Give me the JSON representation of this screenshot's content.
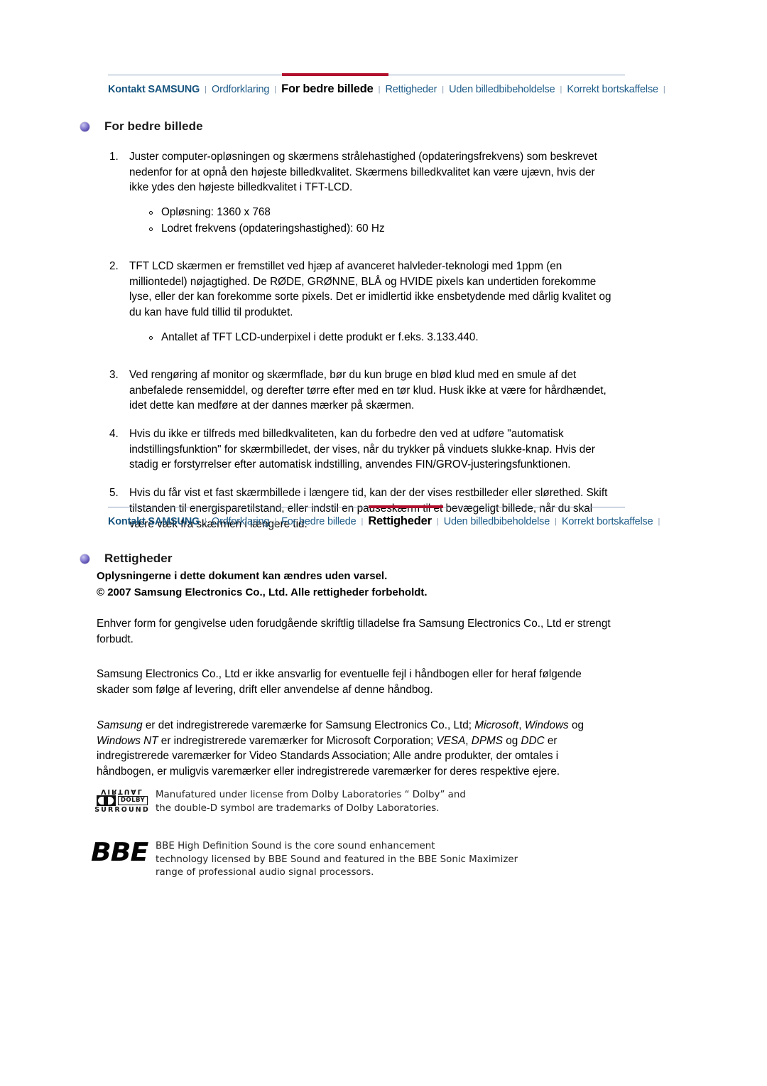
{
  "colors": {
    "nav_link": "#1f5c88",
    "nav_active_bar": "#b1102e",
    "nav_rule": "#8fa4be",
    "bullet_orb": "#5b4fb0"
  },
  "nav_top": {
    "items": [
      {
        "label": "Kontakt SAMSUNG",
        "style": "bold"
      },
      {
        "label": "Ordforklaring",
        "style": "link"
      },
      {
        "label": "For bedre billede",
        "style": "active"
      },
      {
        "label": "Rettigheder",
        "style": "link"
      },
      {
        "label": "Uden billedbibeholdelse",
        "style": "link"
      },
      {
        "label": "Korrekt bortskaffelse",
        "style": "link"
      }
    ]
  },
  "nav_bottom": {
    "items": [
      {
        "label": "Kontakt SAMSUNG",
        "style": "bold"
      },
      {
        "label": "Ordforklaring",
        "style": "link"
      },
      {
        "label": "For bedre billede",
        "style": "link"
      },
      {
        "label": "Rettigheder",
        "style": "active"
      },
      {
        "label": "Uden billedbibeholdelse",
        "style": "link"
      },
      {
        "label": "Korrekt bortskaffelse",
        "style": "link"
      }
    ]
  },
  "section_picture": {
    "title": "For bedre billede",
    "item1": "Juster computer-opløsningen og skærmens strålehastighed (opdateringsfrekvens) som beskrevet nedenfor for at opnå den højeste billedkvalitet. Skærmens billedkvalitet kan være ujævn, hvis der ikke ydes den højeste billedkvalitet i TFT-LCD.",
    "item1_sub1": "Opløsning: 1360 x 768",
    "item1_sub2": "Lodret frekvens (opdateringshastighed): 60 Hz",
    "item2": "TFT LCD skærmen er fremstillet ved hjæp af avanceret halvleder-teknologi med 1ppm (en milliontedel) nøjagtighed. De RØDE, GRØNNE, BLÅ og HVIDE pixels kan undertiden forekomme lyse, eller der kan forekomme sorte pixels. Det er imidlertid ikke ensbetydende med dårlig kvalitet og du kan have fuld tillid til produktet.",
    "item2_sub1": "Antallet af TFT LCD-underpixel i dette produkt er f.eks. 3.133.440.",
    "item3": "Ved rengøring af monitor og skærmflade, bør du kun bruge en blød klud med en smule af det anbefalede rensemiddel, og derefter tørre efter med en tør klud. Husk ikke at være for hårdhændet, idet dette kan medføre at der dannes mærker på skærmen.",
    "item4": "Hvis du ikke er tilfreds med billedkvaliteten, kan du forbedre den ved at udføre \"automatisk indstillingsfunktion\" for skærmbilledet, der vises, når du trykker på vinduets slukke-knap. Hvis der stadig er forstyrrelser efter automatisk indstilling, anvendes FIN/GROV-justeringsfunktionen.",
    "item5": "Hvis du får vist et fast skærmbillede i længere tid, kan der der vises restbilleder eller slørethed. Skift tilstanden til energisparetilstand, eller indstil en pauseskærm til et bevægeligt billede, når du skal være væk fra skærmen i længere tid.",
    "numbers": {
      "n1": "1.",
      "n2": "2.",
      "n3": "3.",
      "n4": "4.",
      "n5": "5."
    }
  },
  "section_rights": {
    "title": "Rettigheder",
    "notice_line1": "Oplysningerne i dette dokument kan ændres uden varsel.",
    "notice_line2": "© 2007 Samsung Electronics Co., Ltd. Alle rettigheder forbeholdt.",
    "para1": "Enhver form for gengivelse uden forudgående skriftlig tilladelse fra Samsung Electronics Co., Ltd er strengt forbudt.",
    "para2": "Samsung Electronics Co., Ltd er ikke ansvarlig for eventuelle fejl i håndbogen eller for heraf følgende skader som følge af levering, drift eller anvendelse af denne håndbog.",
    "para3": {
      "t1": "Samsung",
      "t2": " er det indregistrerede varemærke for Samsung Electronics Co., Ltd; ",
      "t3": "Microsoft",
      "t4": ", ",
      "t5": "Windows",
      "t6": " og ",
      "t7": "Windows NT",
      "t8": " er indregistrerede varemærker for Microsoft Corporation; ",
      "t9": "VESA",
      "t10": ", ",
      "t11": "DPMS",
      "t12": " og ",
      "t13": "DDC",
      "t14": " er indregistrerede varemærker for Video Standards Association; Alle andre produkter, der omtales i håndbogen, er muligvis varemærker eller indregistrerede varemærker for deres respektive ejere."
    }
  },
  "dolby": {
    "logo_virtual": "VIRTUAL",
    "logo_word": "DOLBY",
    "logo_surround": "SURROUND",
    "text_line1": "Manufatured under license from Dolby Laboratories “ Dolby” and",
    "text_line2": "the double-D symbol are trademarks of Dolby Laboratories."
  },
  "bbe": {
    "logo_text": "BBE",
    "text_line1": "BBE High Definition Sound is the core sound enhancement",
    "text_line2": "technology licensed by BBE Sound and featured in the BBE Sonic Maximizer",
    "text_line3": "range of professional audio signal processors."
  }
}
